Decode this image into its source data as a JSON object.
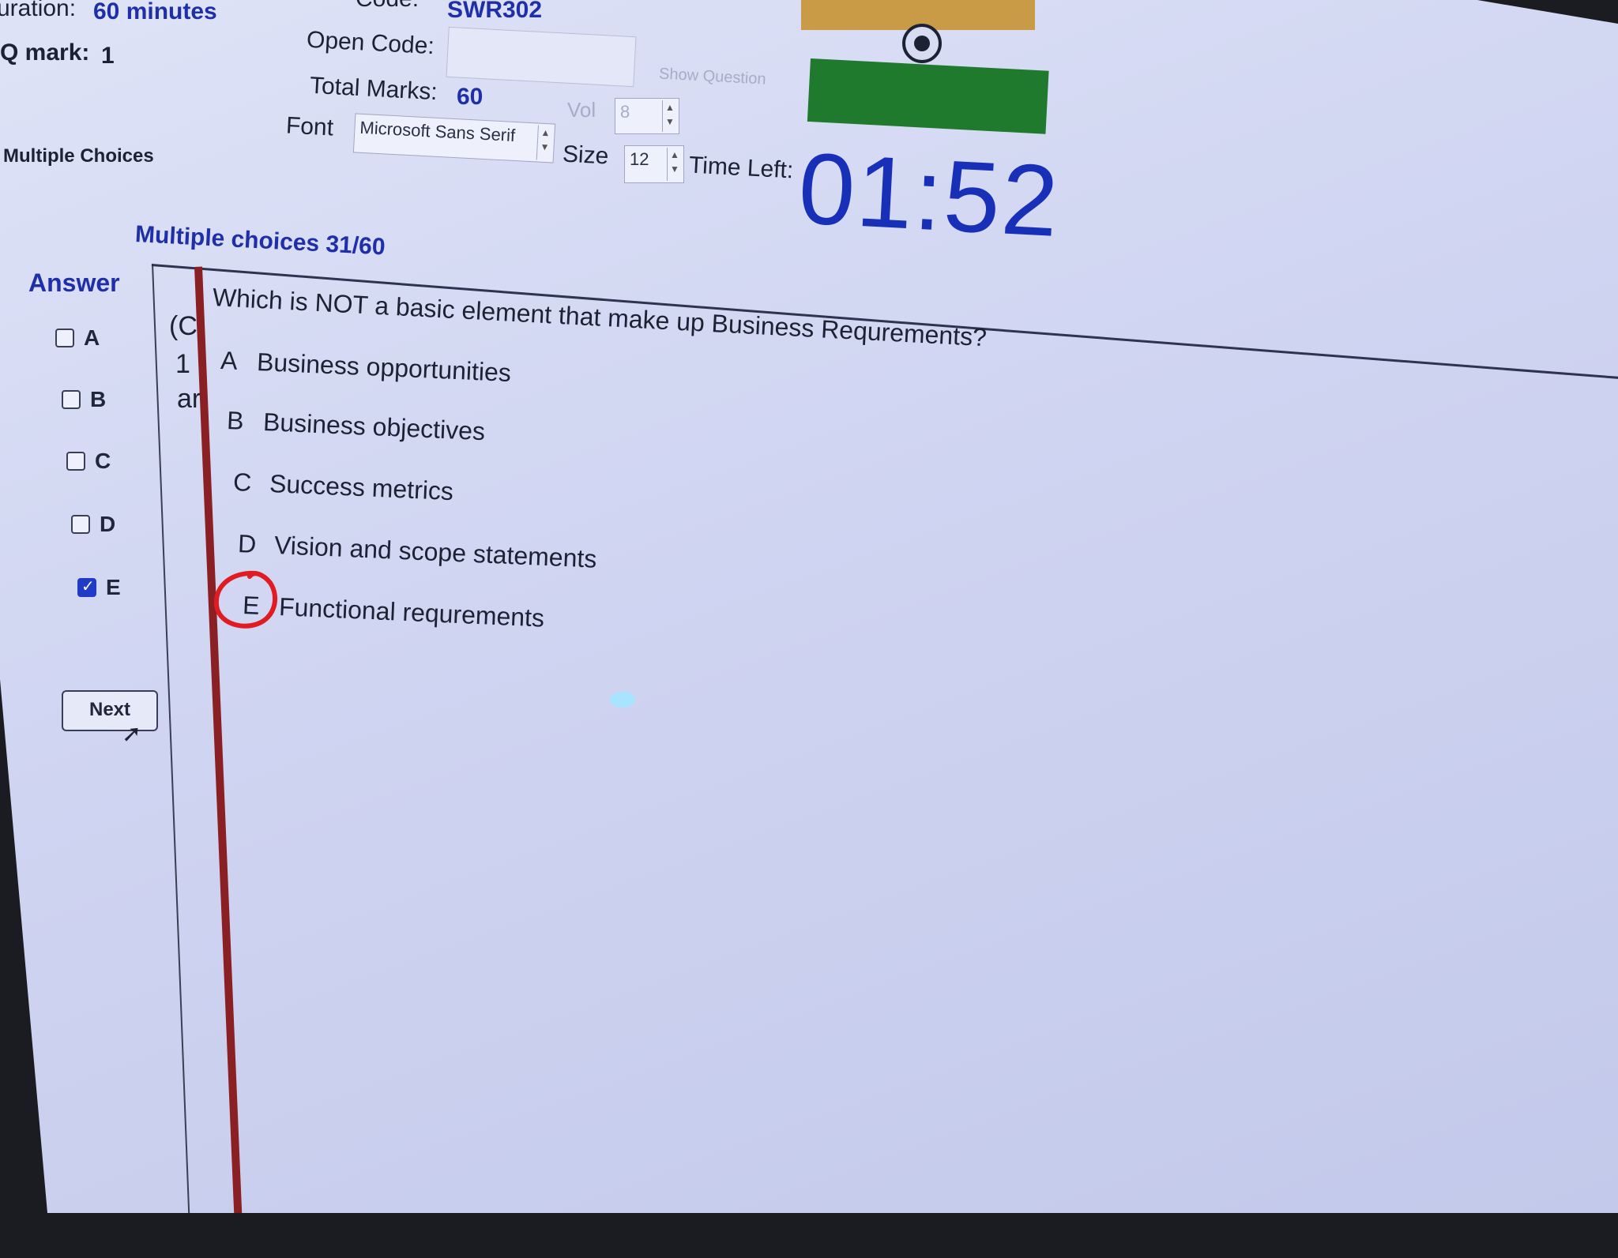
{
  "header": {
    "duration_label": "uration:",
    "duration_value": "60 minutes",
    "q_mark_label": "Q mark:",
    "q_mark_value": "1",
    "section_label": "Multiple Choices",
    "code_label": "Code:",
    "code_value": "SWR302",
    "open_code_label": "Open Code:",
    "open_code_value": "",
    "show_question_label": "Show Question",
    "total_marks_label": "Total Marks:",
    "total_marks_value": "60",
    "vol_label": "Vol",
    "vol_value": "8",
    "font_label": "Font",
    "font_value": "Microsoft Sans Serif",
    "size_label": "Size",
    "size_value": "12",
    "time_left_label": "Time Left:",
    "time_left_value": "01:52"
  },
  "colors": {
    "orange_bar": "#c99b47",
    "green_bar": "#1f7a2d",
    "accent_blue": "#1f2fa8",
    "divider_red": "#8a1f24",
    "annotation_red": "#e11b22"
  },
  "question_panel": {
    "title": "Multiple choices 31/60",
    "question": "Which is NOT a basic element that make up Business Requrements?",
    "side_fragments": [
      "(C",
      "1",
      "ar"
    ],
    "choices": [
      {
        "letter": "A",
        "text": "Business opportunities"
      },
      {
        "letter": "B",
        "text": "Business objectives"
      },
      {
        "letter": "C",
        "text": "Success metrics"
      },
      {
        "letter": "D",
        "text": "Vision and scope statements"
      },
      {
        "letter": "E",
        "text": "Functional requrements"
      }
    ]
  },
  "answer_panel": {
    "title": "Answer",
    "options": [
      {
        "label": "A",
        "checked": false
      },
      {
        "label": "B",
        "checked": false
      },
      {
        "label": "C",
        "checked": false
      },
      {
        "label": "D",
        "checked": false
      },
      {
        "label": "E",
        "checked": true
      }
    ],
    "next_button": "Next"
  }
}
